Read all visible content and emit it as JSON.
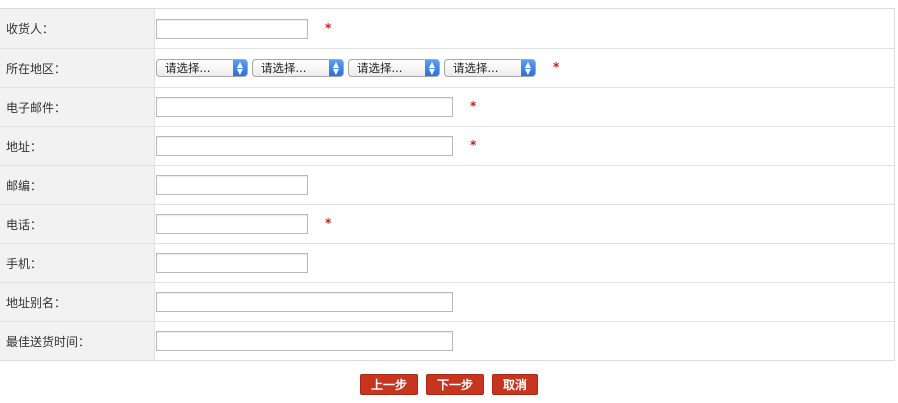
{
  "form": {
    "fields": {
      "consignee": {
        "label": "收货人：",
        "value": "",
        "required_mark": "*"
      },
      "region": {
        "label": "所在地区：",
        "selects": [
          "请选择...",
          "请选择...",
          "请选择...",
          "请选择..."
        ],
        "required_mark": "*"
      },
      "email": {
        "label": "电子邮件：",
        "value": "",
        "required_mark": "*"
      },
      "address": {
        "label": "地址：",
        "value": "",
        "required_mark": "*"
      },
      "zipcode": {
        "label": "邮编：",
        "value": ""
      },
      "phone": {
        "label": "电话：",
        "value": "",
        "required_mark": "*"
      },
      "mobile": {
        "label": "手机：",
        "value": ""
      },
      "address_alias": {
        "label": "地址别名：",
        "value": ""
      },
      "best_time": {
        "label": "最佳送货时间：",
        "value": ""
      }
    }
  },
  "buttons": {
    "prev": "上一步",
    "next": "下一步",
    "cancel": "取消"
  },
  "colors": {
    "required": "#d01818",
    "button": "#c8351f",
    "label_bg": "#f2f2f2"
  },
  "icons": {
    "select_arrow": "up-down-chevron-icon"
  }
}
